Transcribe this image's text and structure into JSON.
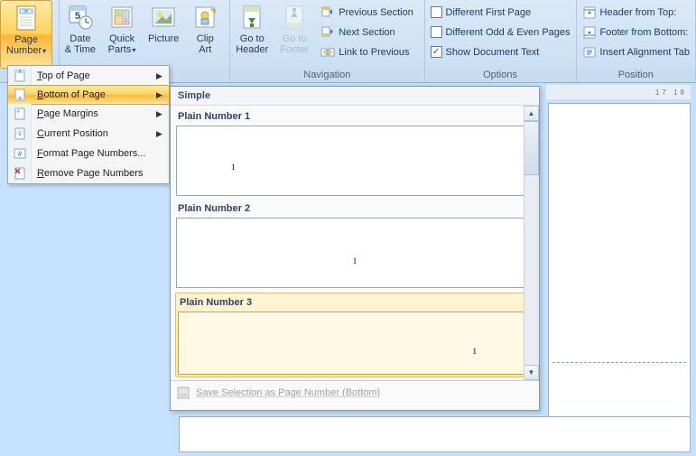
{
  "ribbon": {
    "pageNumber": {
      "label1": "Page",
      "label2": "Number"
    },
    "dateTime": {
      "label1": "Date",
      "label2": "& Time"
    },
    "quickParts": {
      "label1": "Quick",
      "label2": "Parts"
    },
    "picture": {
      "label": "Picture"
    },
    "clipArt": {
      "label1": "Clip",
      "label2": "Art"
    },
    "gotoHeader": {
      "label1": "Go to",
      "label2": "Header"
    },
    "gotoFooter": {
      "label1": "Go to",
      "label2": "Footer"
    },
    "navItems": {
      "prev": "Previous Section",
      "next": "Next Section",
      "link": "Link to Previous"
    },
    "navLabel": "Navigation",
    "options": {
      "diffFirst": "Different First Page",
      "diffOdd": "Different Odd & Even Pages",
      "showDoc": "Show Document Text"
    },
    "optionsLabel": "Options",
    "position": {
      "headerTop": "Header from Top:",
      "footerBottom": "Footer from Bottom:",
      "alignTab": "Insert Alignment Tab"
    },
    "positionLabel": "Position"
  },
  "menu": {
    "top": "Top of Page",
    "bottom": "Bottom of Page",
    "margins": "Page Margins",
    "current": "Current Position",
    "format": "Format Page Numbers...",
    "remove": "Remove Page Numbers"
  },
  "gallery": {
    "header": "Simple",
    "item1": "Plain Number 1",
    "item2": "Plain Number 2",
    "item3": "Plain Number 3",
    "num": "1",
    "footer": "Save Selection as Page Number (Bottom)"
  },
  "ruler": "17 18"
}
